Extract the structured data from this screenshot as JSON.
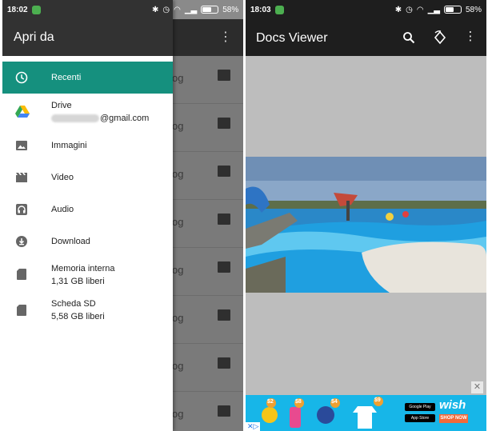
{
  "left_screen": {
    "status": {
      "time": "18:02",
      "battery": "58%",
      "battery_level": 0.58
    },
    "drawer": {
      "title": "Apri da",
      "items": [
        {
          "label": "Recenti",
          "icon": "clock-icon",
          "active": true
        },
        {
          "label": "Drive",
          "sublabel": "@gmail.com",
          "icon": "google-drive-icon"
        },
        {
          "label": "Immagini",
          "icon": "image-icon"
        },
        {
          "label": "Video",
          "icon": "video-clapper-icon"
        },
        {
          "label": "Audio",
          "icon": "headphones-icon"
        },
        {
          "label": "Download",
          "icon": "download-icon"
        },
        {
          "label": "Memoria interna",
          "sublabel": "1,31 GB liberi",
          "icon": "sd-card-icon"
        },
        {
          "label": "Scheda SD",
          "sublabel": "5,58 GB liberi",
          "icon": "sd-card-icon"
        }
      ]
    },
    "background_list": {
      "rows": [
        {
          "suffix": "og"
        },
        {
          "suffix": "og"
        },
        {
          "suffix": "og"
        },
        {
          "suffix": "og"
        },
        {
          "suffix": "og"
        },
        {
          "suffix": "og"
        },
        {
          "suffix": "og"
        },
        {
          "suffix": "og"
        }
      ]
    }
  },
  "right_screen": {
    "status": {
      "time": "18:03",
      "battery": "58%",
      "battery_level": 0.58
    },
    "appbar": {
      "title": "Docs Viewer"
    },
    "ad": {
      "brand": "wish",
      "cta": "SHOP NOW",
      "badges": [
        "Google Play",
        "App Store"
      ],
      "prices": [
        "$2",
        "$8",
        "$4",
        "$9"
      ]
    }
  },
  "colors": {
    "accent": "#15907e",
    "drawer_header": "#323232",
    "appbar_right": "#1e1e1e",
    "ad_bg": "#17b6e8"
  }
}
